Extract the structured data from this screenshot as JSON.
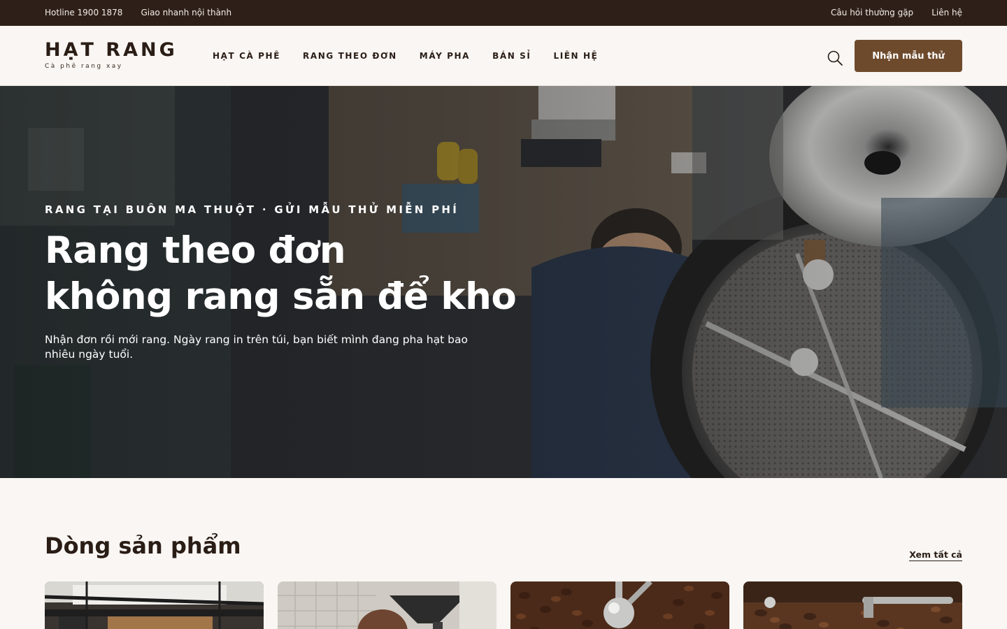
{
  "topbar": {
    "hotline": "Hotline 1900 1878",
    "delivery": "Giao nhanh nội thành",
    "faq": "Câu hỏi thường gặp",
    "contact": "Liên hệ"
  },
  "header": {
    "logo_name": "HẠT RANG",
    "logo_tagline": "Cà phê rang xay",
    "nav": [
      {
        "label": "HẠT CÀ PHÊ"
      },
      {
        "label": "RANG THEO ĐƠN"
      },
      {
        "label": "MÁY PHA"
      },
      {
        "label": "BÁN SỈ"
      },
      {
        "label": "LIÊN HỆ"
      }
    ],
    "search_icon": "search-icon",
    "cta_label": "Nhận mẫu thử"
  },
  "hero": {
    "eyebrow": "RANG TẠI BUÔN MA THUỘT · GỬI MẪU THỬ MIỄN PHÍ",
    "title_line1": "Rang theo đơn",
    "title_line2": "không rang sẵn để kho",
    "subtitle": "Nhận đơn rồi mới rang. Ngày rang in trên túi, bạn biết mình đang pha hạt bao nhiêu ngày tuổi."
  },
  "products": {
    "title": "Dòng sản phẩm",
    "see_all": "Xem tất cả"
  },
  "colors": {
    "topbar_bg": "#2e2019",
    "page_bg": "#f9f6f3",
    "accent": "#6e4a2c",
    "text_dark": "#2a1d16"
  }
}
